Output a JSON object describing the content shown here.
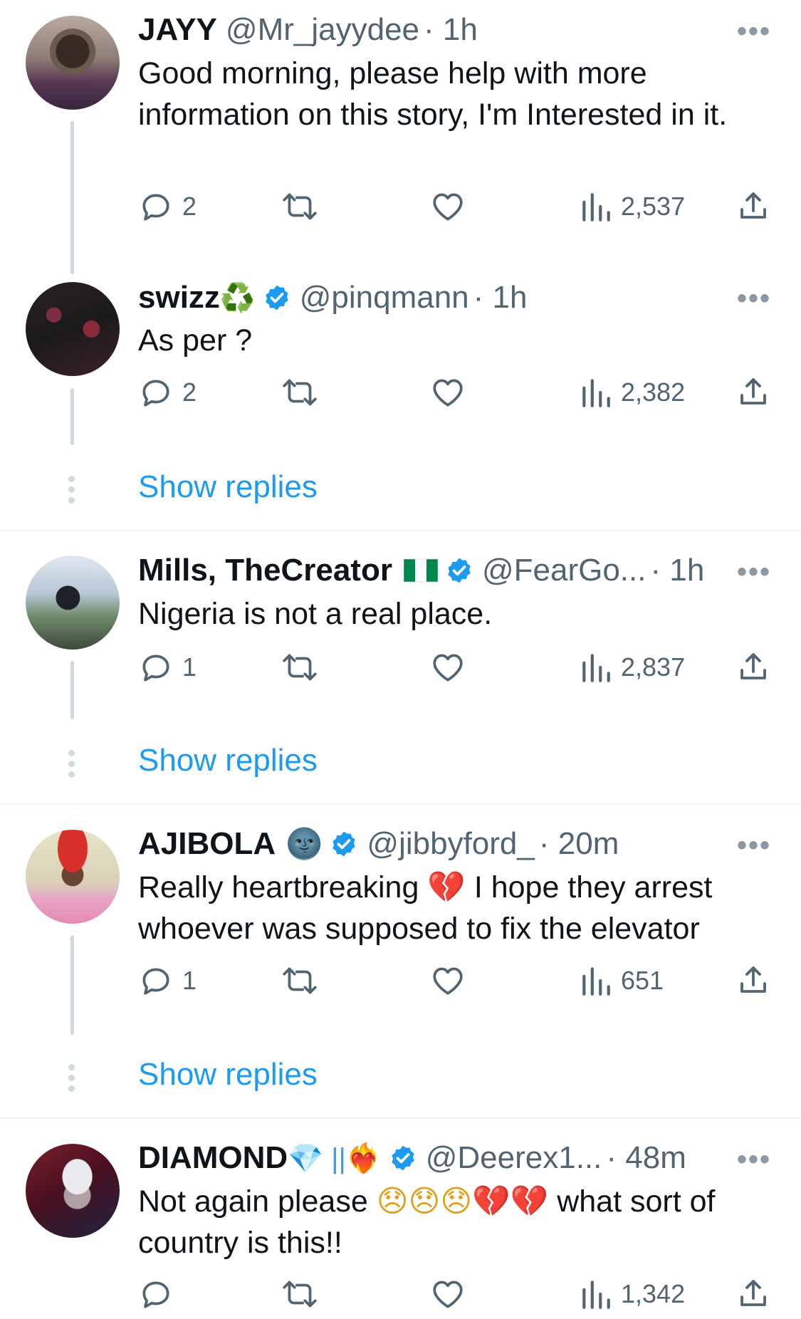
{
  "tweets": [
    {
      "name": "JAYY",
      "handle": "@Mr_jayydee",
      "time": "· 1h",
      "text": "Good morning, please help with more information on this story, I'm Interested in it.",
      "replies": "2",
      "views": "2,537"
    },
    {
      "name": "swizz",
      "name_emoji": "♻️",
      "verified": true,
      "handle": "@pinqmann",
      "time": "· 1h",
      "text": "As per ?",
      "replies": "2",
      "views": "2,382",
      "show_replies": "Show replies"
    },
    {
      "name": "Mills, TheCreator",
      "verified": true,
      "handle": "@FearGo...",
      "time": "· 1h",
      "text": "Nigeria is not a real place.",
      "replies": "1",
      "views": "2,837",
      "show_replies": "Show replies"
    },
    {
      "name": "AJIBOLA",
      "name_emoji": "🌚",
      "verified": true,
      "handle": "@jibbyford_",
      "time": "· 20m",
      "text_part1": "Really heartbreaking ",
      "text_emoji": "💔",
      "text_part2": " I hope they arrest whoever was supposed to fix the elevator",
      "replies": "1",
      "views": "651",
      "show_replies": "Show replies"
    },
    {
      "name": "DIAMOND",
      "name_emoji": "💎 ||❤️‍🔥",
      "verified": true,
      "handle": "@Deerex1...",
      "time": "· 48m",
      "text_part1": "Not again please ",
      "text_emoji": "😞😞😞💔💔",
      "text_part2": " what sort of country is this!!",
      "replies": "",
      "views": "1,342"
    }
  ],
  "more_glyph": "•••",
  "colors": {
    "accent": "#1d9bf0",
    "text": "#0f1419",
    "muted": "#536471",
    "line": "#cfd9de"
  },
  "icons": [
    "reply-icon",
    "retweet-icon",
    "like-icon",
    "views-icon",
    "share-icon",
    "verified-badge-icon",
    "more-icon",
    "nigeria-flag-icon"
  ]
}
